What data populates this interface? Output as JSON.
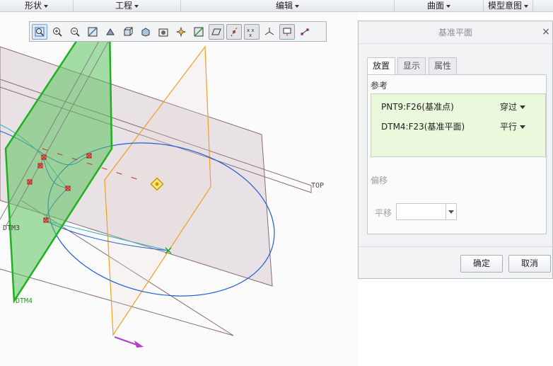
{
  "menubar": {
    "shape": "形状",
    "engineering": "工程",
    "edit": "编辑",
    "surface": "曲面",
    "model_intent": "模型意图"
  },
  "toolbar": {
    "icons": [
      "refit-icon",
      "zoom-in-icon",
      "zoom-out-icon",
      "repaint-icon",
      "display-style-icon",
      "saved-orientations-icon",
      "named-views-icon",
      "view-manager-icon",
      "perspective-icon",
      "section-icon",
      "plane-display-icon",
      "axis-display-icon",
      "point-display-icon",
      "csys-display-icon",
      "annotation-display-icon",
      "spin-center-icon"
    ]
  },
  "viewport": {
    "labels": {
      "top": "TOP",
      "dtm3": "DTM3",
      "dtm4": "DTM4"
    }
  },
  "dialog": {
    "title": "基准平面",
    "close": "×",
    "tabs": [
      "放置",
      "显示",
      "属性"
    ],
    "references_label": "参考",
    "references": [
      {
        "name": "PNT9:F26(基准点)",
        "constraint": "穿过"
      },
      {
        "name": "DTM4:F23(基准平面)",
        "constraint": "平行"
      }
    ],
    "offset_label": "偏移",
    "translate_label": "平移",
    "translate_value": "",
    "ok_label": "确定",
    "cancel_label": "取消"
  }
}
